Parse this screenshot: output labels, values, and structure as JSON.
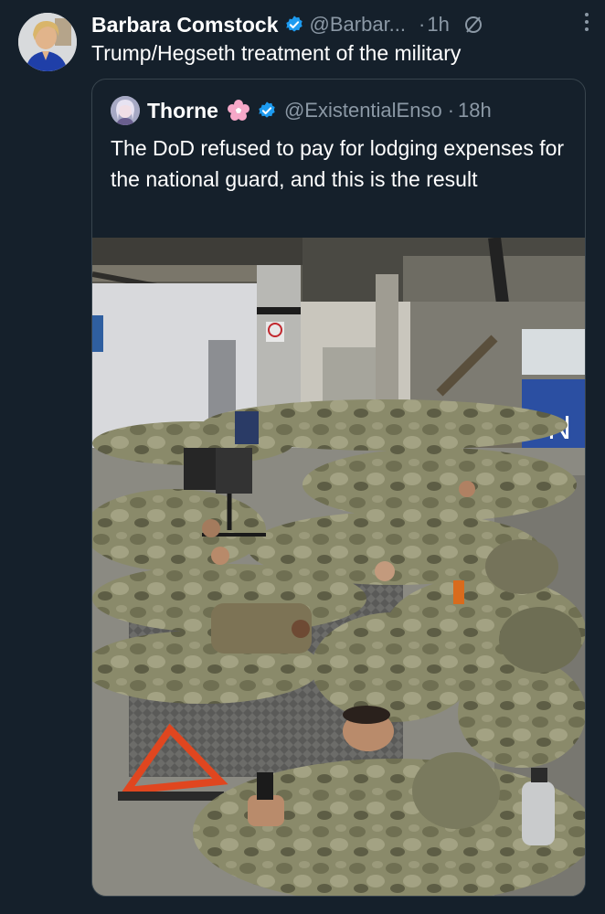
{
  "tweet": {
    "author_name": "Barbara Comstock",
    "author_handle": "@Barbar...",
    "separator": "·",
    "time": "1h",
    "text": "Trump/Hegseth treatment of the military"
  },
  "quote": {
    "author_name": "Thorne",
    "author_handle": "@ExistentialEnso",
    "separator": "·",
    "time": "18h",
    "text": "The DoD refused to pay for lodging expenses for the national guard, and this is the result"
  },
  "photo": {
    "sign_letter": "N"
  },
  "colors": {
    "background": "#15202b",
    "verified": "#1d9bf0",
    "muted_text": "#8b98a5",
    "border": "#38444d"
  },
  "icons": [
    "verified-badge-icon",
    "edited-icon",
    "more-icon",
    "cherry-blossom-icon"
  ]
}
